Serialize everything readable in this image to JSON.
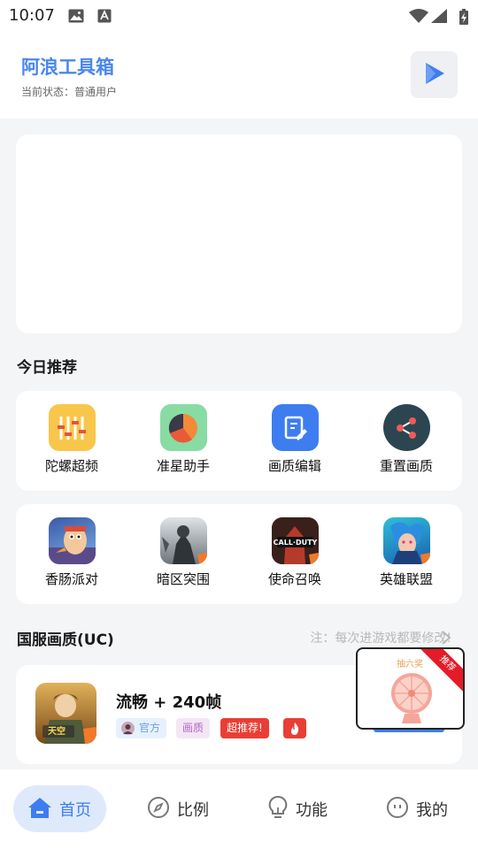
{
  "status_bar": {
    "time": "10:07"
  },
  "header": {
    "title": "阿浪工具箱",
    "status": "当前状态：普通用户",
    "play_icon": "play-icon"
  },
  "colors": {
    "accent": "#3e7df0",
    "title_blue": "#4a86f0",
    "hot_red": "#e83e35"
  },
  "today": {
    "title": "今日推荐",
    "tools": [
      {
        "label": "陀螺超频",
        "icon": "tuning-sliders-icon",
        "color": "#f8c64a"
      },
      {
        "label": "准星助手",
        "icon": "pie-chart-icon",
        "color": "#89dba4"
      },
      {
        "label": "画质编辑",
        "icon": "edit-doc-icon",
        "color": "#3e7df0"
      },
      {
        "label": "重置画质",
        "icon": "share-icon",
        "color": "#2b4650"
      }
    ],
    "games": [
      {
        "label": "香肠派对",
        "icon": "sausage-party-icon"
      },
      {
        "label": "暗区突围",
        "icon": "arena-breakout-icon"
      },
      {
        "label": "使命召唤",
        "icon": "call-of-duty-icon"
      },
      {
        "label": "英雄联盟",
        "icon": "league-of-legends-icon"
      }
    ]
  },
  "uc": {
    "title": "国服画质(UC)",
    "note": "注：每次进游戏都要修改!",
    "game": {
      "name": "流畅 + 240帧",
      "tags": {
        "official": "官方",
        "quality": "画质",
        "hot": "超推荐!"
      }
    }
  },
  "float_ad": {
    "label": "抽六奖",
    "ribbon": "推荐"
  },
  "tabs": [
    {
      "label": "首页",
      "icon": "home-icon",
      "active": true
    },
    {
      "label": "比例",
      "icon": "compass-icon",
      "active": false
    },
    {
      "label": "功能",
      "icon": "lightbulb-icon",
      "active": false
    },
    {
      "label": "我的",
      "icon": "profile-face-icon",
      "active": false
    }
  ]
}
